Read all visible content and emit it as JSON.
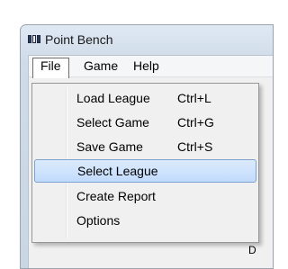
{
  "window": {
    "title": "Point Bench"
  },
  "menubar": {
    "items": [
      "File",
      "Game",
      "Help"
    ]
  },
  "file_menu": {
    "items": [
      {
        "label": "Load League",
        "shortcut": "Ctrl+L"
      },
      {
        "label": "Select Game",
        "shortcut": "Ctrl+G"
      },
      {
        "label": "Save Game",
        "shortcut": "Ctrl+S"
      },
      {
        "label": "Select League",
        "shortcut": "",
        "highlighted": true
      },
      {
        "label": "Create Report",
        "shortcut": ""
      },
      {
        "label": "Options",
        "shortcut": ""
      }
    ]
  },
  "edge_text": "D"
}
